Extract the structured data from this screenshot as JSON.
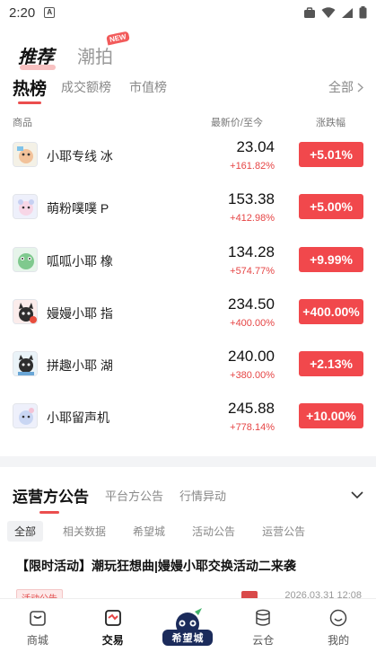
{
  "status_bar": {
    "time": "2:20",
    "sim_glyph": "A"
  },
  "top_tabs": [
    {
      "label": "推荐",
      "active": true
    },
    {
      "label": "潮拍",
      "active": false,
      "badge": "NEW"
    }
  ],
  "list_tabs": [
    {
      "label": "热榜",
      "active": true
    },
    {
      "label": "成交额榜",
      "active": false
    },
    {
      "label": "市值榜",
      "active": false
    }
  ],
  "all_link": "全部",
  "table_header": {
    "product": "商品",
    "price": "最新价/至今",
    "change": "涨跌幅"
  },
  "rows": [
    {
      "name": "小耶专线 冰",
      "price": "23.04",
      "since": "+161.82%",
      "change": "+5.01%"
    },
    {
      "name": "萌粉噗噗 P",
      "price": "153.38",
      "since": "+412.98%",
      "change": "+5.00%"
    },
    {
      "name": "呱呱小耶 橡",
      "price": "134.28",
      "since": "+574.77%",
      "change": "+9.99%"
    },
    {
      "name": "嫚嫚小耶 指",
      "price": "234.50",
      "since": "+400.00%",
      "change": "+400.00%"
    },
    {
      "name": "拼趣小耶 湖",
      "price": "240.00",
      "since": "+380.00%",
      "change": "+2.13%"
    },
    {
      "name": "小耶留声机",
      "price": "245.88",
      "since": "+778.14%",
      "change": "+10.00%"
    }
  ],
  "announcement_tabs": [
    {
      "label": "运营方公告",
      "active": true
    },
    {
      "label": "平台方公告",
      "active": false
    },
    {
      "label": "行情异动",
      "active": false
    }
  ],
  "filters": [
    {
      "label": "全部",
      "active": true
    },
    {
      "label": "相关数据",
      "active": false
    },
    {
      "label": "希望城",
      "active": false
    },
    {
      "label": "活动公告",
      "active": false
    },
    {
      "label": "运营公告",
      "active": false
    }
  ],
  "announcement": {
    "title": "【限时活动】潮玩狂想曲|嫚嫚小耶交换活动二来袭",
    "tag": "活动公告",
    "date": "2026.03.31 12:08"
  },
  "bottom_nav": [
    {
      "label": "商城",
      "icon": "shop-icon",
      "active": false
    },
    {
      "label": "交易",
      "icon": "trade-icon",
      "active": true
    },
    {
      "label": "希望城",
      "icon": "hope-city-logo",
      "active": false
    },
    {
      "label": "云仓",
      "icon": "cloud-storage-icon",
      "active": false
    },
    {
      "label": "我的",
      "icon": "profile-icon",
      "active": false
    }
  ],
  "colors": {
    "accent_red": "#f1484c",
    "up_text": "#e64545",
    "brand_navy": "#1b2b5b"
  }
}
